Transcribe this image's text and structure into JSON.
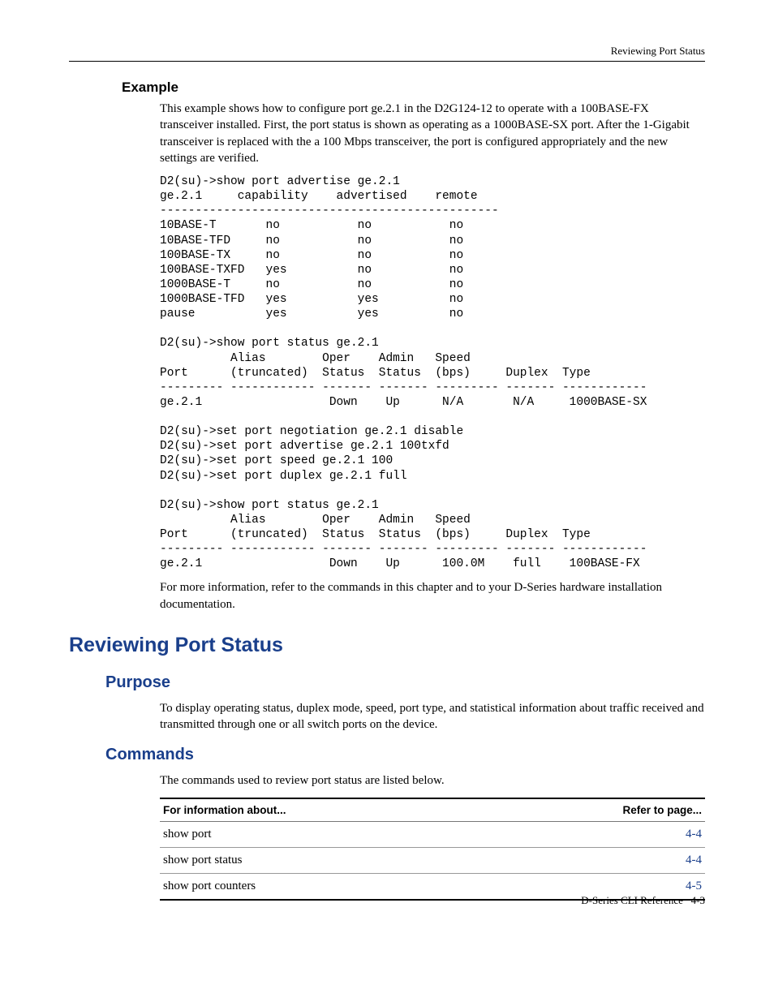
{
  "running_head": "Reviewing Port Status",
  "example": {
    "heading": "Example",
    "para": "This example shows how to configure port ge.2.1 in the D2G124-12 to operate with a 100BASE-FX transceiver installed. First, the port status is shown as operating as a 1000BASE-SX port. After the 1-Gigabit transceiver is replaced with the a 100 Mbps transceiver, the port is configured appropriately and the new settings are verified.",
    "code": "D2(su)->show port advertise ge.2.1\nge.2.1     capability    advertised    remote\n------------------------------------------------\n10BASE-T       no           no           no\n10BASE-TFD     no           no           no\n100BASE-TX     no           no           no\n100BASE-TXFD   yes          no           no\n1000BASE-T     no           no           no\n1000BASE-TFD   yes          yes          no\npause          yes          yes          no\n\nD2(su)->show port status ge.2.1\n          Alias        Oper    Admin   Speed\nPort      (truncated)  Status  Status  (bps)     Duplex  Type\n--------- ------------ ------- ------- --------- ------- ------------\nge.2.1                  Down    Up      N/A       N/A     1000BASE-SX\n\nD2(su)->set port negotiation ge.2.1 disable\nD2(su)->set port advertise ge.2.1 100txfd\nD2(su)->set port speed ge.2.1 100\nD2(su)->set port duplex ge.2.1 full\n\nD2(su)->show port status ge.2.1\n          Alias        Oper    Admin   Speed\nPort      (truncated)  Status  Status  (bps)     Duplex  Type\n--------- ------------ ------- ------- --------- ------- ------------\nge.2.1                  Down    Up      100.0M    full    100BASE-FX",
    "after_code": "For more information, refer to the commands in this chapter and to your D-Series hardware installation documentation."
  },
  "section": {
    "title": "Reviewing Port Status",
    "purpose_h": "Purpose",
    "purpose_text": "To display operating status, duplex mode, speed, port type, and statistical information about traffic received and transmitted through one or all switch ports on the device.",
    "commands_h": "Commands",
    "commands_intro": "The commands used to review port status are listed below.",
    "table": {
      "col1": "For information about...",
      "col2": "Refer to page...",
      "rows": [
        {
          "cmd": "show port",
          "page": "4-4"
        },
        {
          "cmd": "show port status",
          "page": "4-4"
        },
        {
          "cmd": "show port counters",
          "page": "4-5"
        }
      ]
    }
  },
  "footer": {
    "left": "D-Series CLI Reference",
    "right": "4-3"
  }
}
